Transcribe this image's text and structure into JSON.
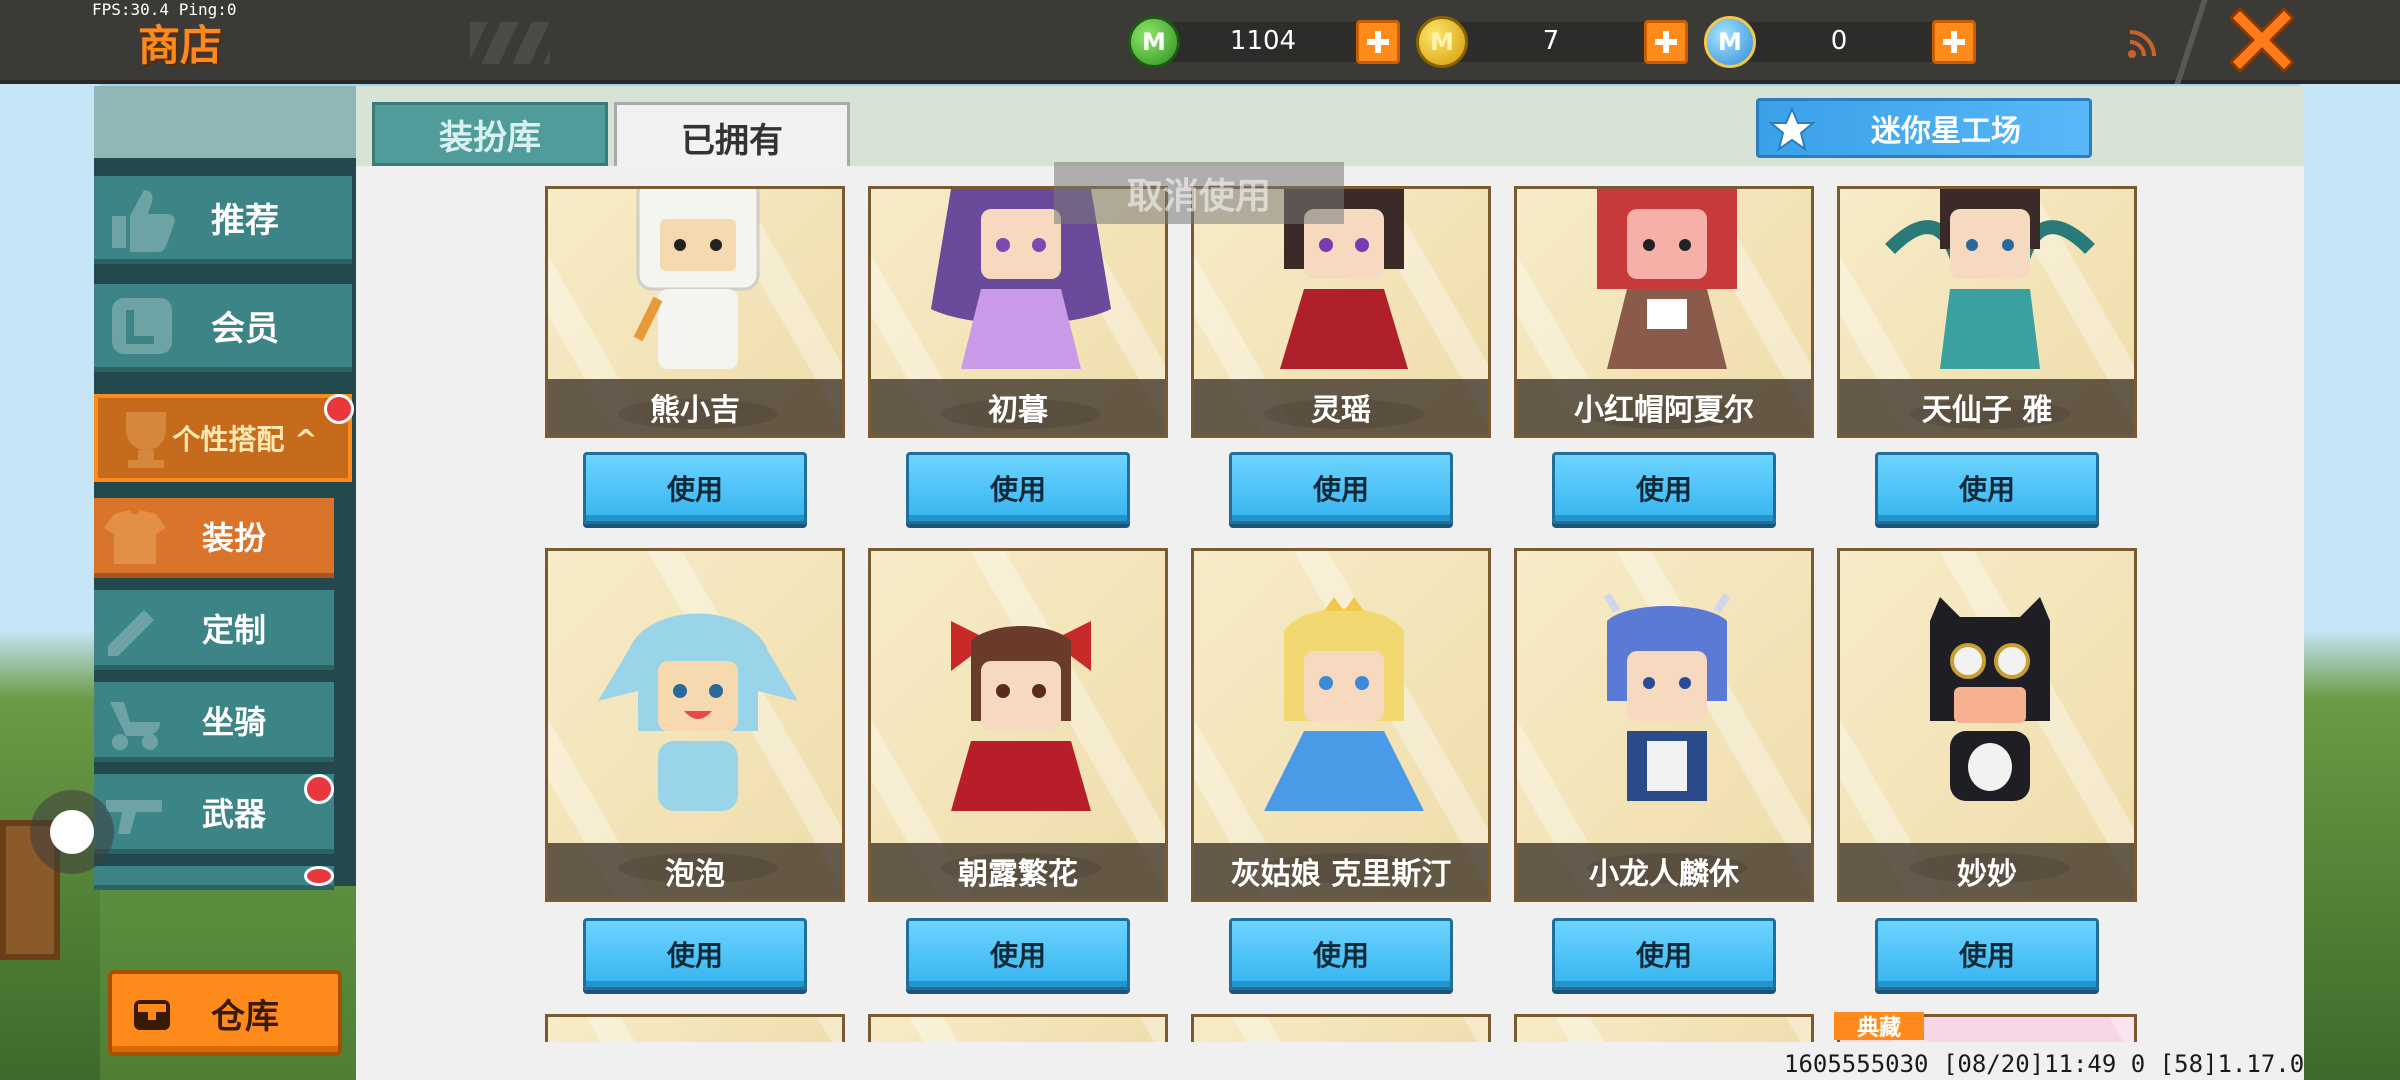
{
  "hud": {
    "fps": "FPS:30.4  Ping:0",
    "title": "商店"
  },
  "currencies": [
    {
      "icon": "green-m-coin-icon",
      "value": "1104"
    },
    {
      "icon": "gold-m-coin-icon",
      "value": "7"
    },
    {
      "icon": "blue-m-coin-icon",
      "value": "0"
    }
  ],
  "tabs": {
    "wardrobe": "装扮库",
    "owned": "已拥有"
  },
  "workshop": {
    "label": "迷你星工场"
  },
  "cancel_banner": "取消使用",
  "sidebar": {
    "recommend": "推荐",
    "member": "会员",
    "personal": "个性搭配",
    "dressup": "装扮",
    "custom": "定制",
    "mount": "坐骑",
    "weapon": "武器",
    "warehouse": "仓库"
  },
  "cards_row1": [
    {
      "name": "熊小吉",
      "button": "使用"
    },
    {
      "name": "初暮",
      "button": "使用"
    },
    {
      "name": "灵瑶",
      "button": "使用"
    },
    {
      "name": "小红帽阿夏尔",
      "button": "使用"
    },
    {
      "name": "天仙子 雅",
      "button": "使用"
    }
  ],
  "cards_row2": [
    {
      "name": "泡泡",
      "button": "使用"
    },
    {
      "name": "朝露繁花",
      "button": "使用"
    },
    {
      "name": "灰姑娘 克里斯汀",
      "button": "使用"
    },
    {
      "name": "小龙人麟休",
      "button": "使用"
    },
    {
      "name": "妙妙",
      "button": "使用"
    }
  ],
  "classic_badge": "典藏",
  "build_info": "1605555030  [08/20]11:49 0  [58]1.17.0",
  "colors": {
    "accent_orange": "#ff8a1c",
    "teal": "#3c8486",
    "use_blue": "#35b4ef"
  }
}
